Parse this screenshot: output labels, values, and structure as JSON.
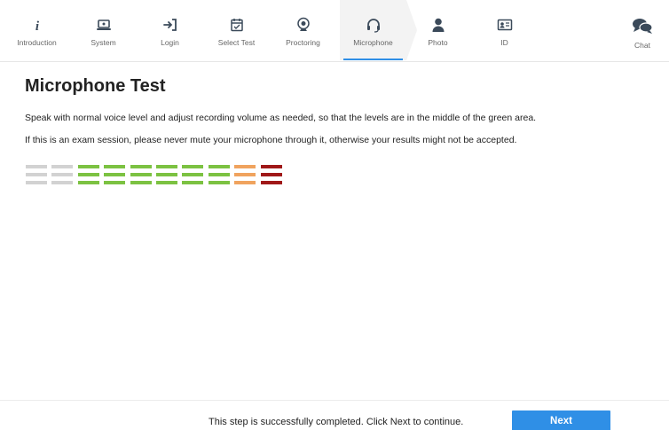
{
  "steps": [
    {
      "label": "Introduction",
      "icon": "info-icon"
    },
    {
      "label": "System",
      "icon": "laptop-icon"
    },
    {
      "label": "Login",
      "icon": "sign-in-icon"
    },
    {
      "label": "Select Test",
      "icon": "calendar-check-icon"
    },
    {
      "label": "Proctoring",
      "icon": "webcam-icon"
    },
    {
      "label": "Microphone",
      "icon": "headset-icon",
      "active": true
    },
    {
      "label": "Photo",
      "icon": "user-icon"
    },
    {
      "label": "ID",
      "icon": "id-card-icon"
    }
  ],
  "chat": {
    "label": "Chat",
    "icon": "chat-bubbles-icon"
  },
  "main": {
    "title": "Microphone Test",
    "instruction": "Speak with normal voice level and adjust recording volume as needed, so that the levels are in the middle of the green area.",
    "warning": "If this is an exam session, please never mute your microphone through it, otherwise your results might not be accepted."
  },
  "meter": {
    "segments": 10,
    "colors": [
      "#d2d2d2",
      "#d2d2d2",
      "#7cc242",
      "#7cc242",
      "#7cc242",
      "#7cc242",
      "#7cc242",
      "#7cc242",
      "#f0a35e",
      "#a01818"
    ]
  },
  "footer": {
    "status": "This step is successfully completed. Click Next to continue.",
    "next_label": "Next"
  },
  "colors": {
    "accent": "#2f8fe6",
    "active_tab_bg": "#f3f3f3"
  }
}
